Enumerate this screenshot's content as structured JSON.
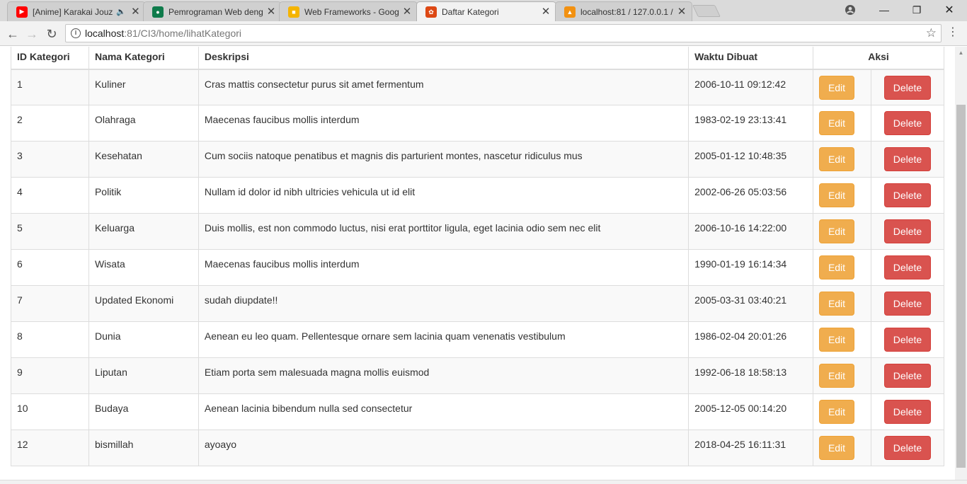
{
  "tabs": [
    {
      "title": "[Anime] Karakai Jouzu",
      "favicon": "youtube-icon",
      "color": "#ff0000",
      "audio": true
    },
    {
      "title": "Pemrograman Web deng",
      "favicon": "classroom-icon",
      "color": "#0f7b4b"
    },
    {
      "title": "Web Frameworks - Goog",
      "favicon": "slides-icon",
      "color": "#f4b400"
    },
    {
      "title": "Daftar Kategori",
      "favicon": "codeigniter-icon",
      "color": "#dd4814",
      "active": true
    },
    {
      "title": "localhost:81 / 127.0.0.1 /",
      "favicon": "phpmyadmin-icon",
      "color": "#f29111"
    }
  ],
  "address": {
    "host": "localhost",
    "path": ":81/CI3/home/lihatKategori"
  },
  "table": {
    "headers": [
      "ID Kategori",
      "Nama Kategori",
      "Deskripsi",
      "Waktu Dibuat",
      "Aksi"
    ],
    "edit_label": "Edit",
    "delete_label": "Delete",
    "rows": [
      {
        "id": "1",
        "nama": "Kuliner",
        "deskripsi": "Cras mattis consectetur purus sit amet fermentum",
        "waktu": "2006-10-11 09:12:42"
      },
      {
        "id": "2",
        "nama": "Olahraga",
        "deskripsi": "Maecenas faucibus mollis interdum",
        "waktu": "1983-02-19 23:13:41"
      },
      {
        "id": "3",
        "nama": "Kesehatan",
        "deskripsi": "Cum sociis natoque penatibus et magnis dis parturient montes, nascetur ridiculus mus",
        "waktu": "2005-01-12 10:48:35"
      },
      {
        "id": "4",
        "nama": "Politik",
        "deskripsi": "Nullam id dolor id nibh ultricies vehicula ut id elit",
        "waktu": "2002-06-26 05:03:56"
      },
      {
        "id": "5",
        "nama": "Keluarga",
        "deskripsi": "Duis mollis, est non commodo luctus, nisi erat porttitor ligula, eget lacinia odio sem nec elit",
        "waktu": "2006-10-16 14:22:00"
      },
      {
        "id": "6",
        "nama": "Wisata",
        "deskripsi": "Maecenas faucibus mollis interdum",
        "waktu": "1990-01-19 16:14:34"
      },
      {
        "id": "7",
        "nama": "Updated Ekonomi",
        "deskripsi": "sudah diupdate!!",
        "waktu": "2005-03-31 03:40:21"
      },
      {
        "id": "8",
        "nama": "Dunia",
        "deskripsi": "Aenean eu leo quam. Pellentesque ornare sem lacinia quam venenatis vestibulum",
        "waktu": "1986-02-04 20:01:26"
      },
      {
        "id": "9",
        "nama": "Liputan",
        "deskripsi": "Etiam porta sem malesuada magna mollis euismod",
        "waktu": "1992-06-18 18:58:13"
      },
      {
        "id": "10",
        "nama": "Budaya",
        "deskripsi": "Aenean lacinia bibendum nulla sed consectetur",
        "waktu": "2005-12-05 00:14:20"
      },
      {
        "id": "12",
        "nama": "bismillah",
        "deskripsi": "ayoayo",
        "waktu": "2018-04-25 16:11:31"
      }
    ]
  },
  "colors": {
    "edit": "#f0ad4e",
    "delete": "#d9534f"
  }
}
